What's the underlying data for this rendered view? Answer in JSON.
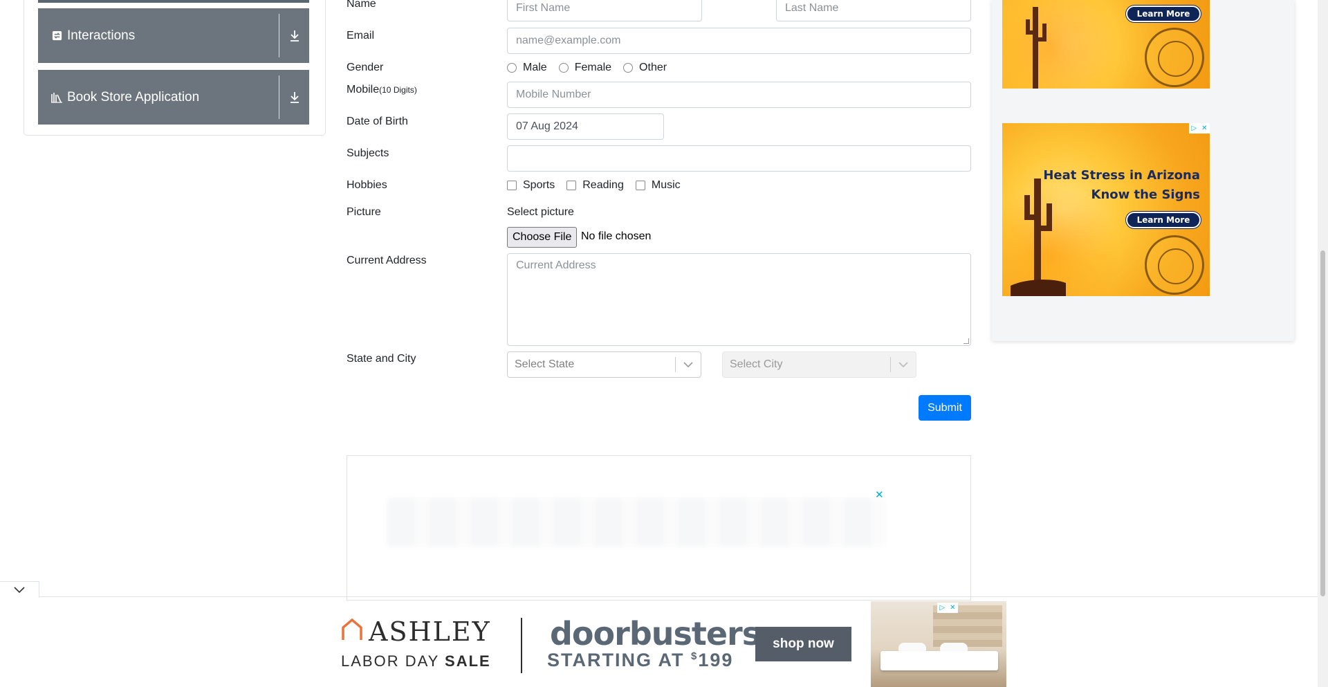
{
  "sidebar": {
    "items": [
      {
        "label": "Interactions",
        "icon": "interactions-icon"
      },
      {
        "label": "Book Store Application",
        "icon": "book-store-icon"
      }
    ]
  },
  "form": {
    "name_label": "Name",
    "first_name_placeholder": "First Name",
    "last_name_placeholder": "Last Name",
    "email_label": "Email",
    "email_placeholder": "name@example.com",
    "gender_label": "Gender",
    "gender_options": [
      "Male",
      "Female",
      "Other"
    ],
    "mobile_label": "Mobile",
    "mobile_hint": "(10 Digits)",
    "mobile_placeholder": "Mobile Number",
    "dob_label": "Date of Birth",
    "dob_value": "07 Aug 2024",
    "subjects_label": "Subjects",
    "hobbies_label": "Hobbies",
    "hobby_options": [
      "Sports",
      "Reading",
      "Music"
    ],
    "picture_label": "Picture",
    "picture_caption": "Select picture",
    "choose_file_label": "Choose File",
    "file_status": "No file chosen",
    "address_label": "Current Address",
    "address_placeholder": "Current Address",
    "state_city_label": "State and City",
    "state_placeholder": "Select State",
    "city_placeholder": "Select City",
    "submit_label": "Submit"
  },
  "ads": {
    "right_ad_line1": "Heat Stress in Arizona",
    "right_ad_line2": "Know the Signs",
    "learn_more": "Learn More",
    "close_symbol": "✕",
    "bottom": {
      "brand": "ASHLEY",
      "sale_word1": "LABOR DAY",
      "sale_word2": "SALE",
      "headline": "doorbusters",
      "starting": "STARTING AT",
      "currency": "$",
      "price": "199",
      "cta": "shop now"
    }
  },
  "colors": {
    "accordion_bg": "#6c757d",
    "submit_bg": "#007bff",
    "ad_navy": "#0f2457"
  }
}
